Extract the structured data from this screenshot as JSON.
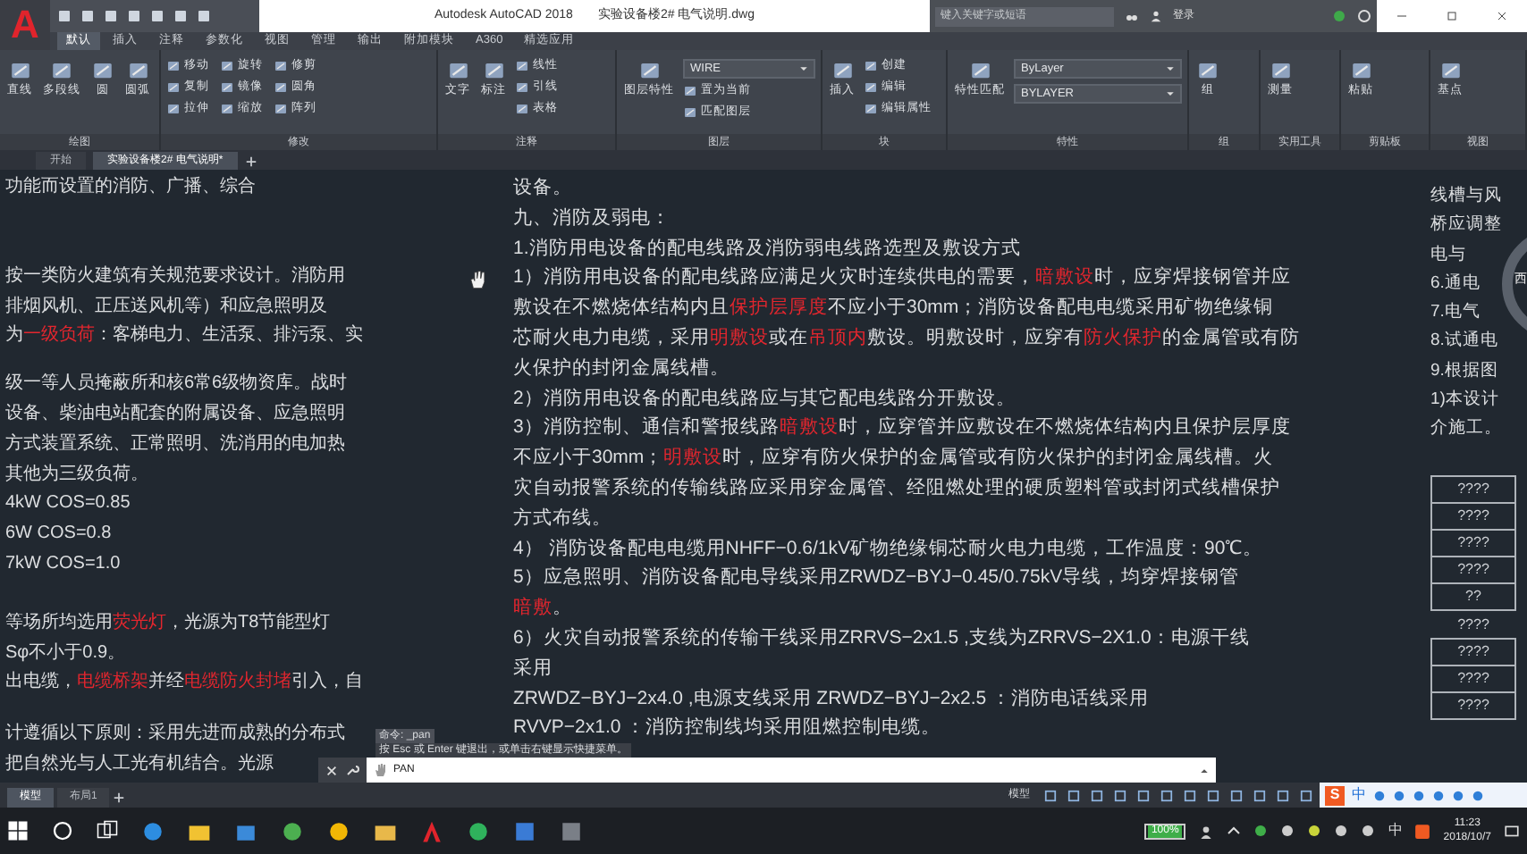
{
  "title_bar": {
    "logo": "A",
    "title": "Autodesk AutoCAD 2018",
    "file": "实验设备楼2# 电气说明.dwg",
    "search": {
      "placeholder": "键入关键字或短语"
    },
    "sign_in": "登录"
  },
  "ribbon_tabs": [
    {
      "label": "默认",
      "selected": true
    },
    {
      "label": "插入",
      "selected": false
    },
    {
      "label": "注释",
      "selected": false
    },
    {
      "label": "参数化",
      "selected": false
    },
    {
      "label": "视图",
      "selected": false
    },
    {
      "label": "管理",
      "selected": false
    },
    {
      "label": "输出",
      "selected": false
    },
    {
      "label": "附加模块",
      "selected": false
    },
    {
      "label": "A360",
      "selected": false
    },
    {
      "label": "精选应用",
      "selected": false
    }
  ],
  "ribbon_panels": [
    {
      "title": "绘图",
      "large": [
        "直线",
        "多段线",
        "圆",
        "圆弧"
      ]
    },
    {
      "title": "修改",
      "small": [
        "移动",
        "旋转",
        "修剪",
        "复制",
        "镜像",
        "圆角",
        "拉伸",
        "缩放",
        "阵列"
      ]
    },
    {
      "title": "注释",
      "large": [
        "文字",
        "标注"
      ],
      "small": [
        "线性",
        "引线",
        "表格"
      ]
    },
    {
      "title": "图层",
      "large": [
        "图层特性"
      ],
      "dropdowns": [
        "WIRE"
      ],
      "small": [
        "置为当前",
        "匹配图层"
      ]
    },
    {
      "title": "块",
      "large": [
        "插入"
      ],
      "small": [
        "创建",
        "编辑",
        "编辑属性"
      ]
    },
    {
      "title": "特性",
      "large": [
        "特性匹配"
      ],
      "dropdowns": [
        "ByLayer",
        "BYLAYER"
      ]
    },
    {
      "title": "组",
      "large": [
        "组"
      ]
    },
    {
      "title": "实用工具",
      "large": [
        "测量"
      ]
    },
    {
      "title": "剪贴板",
      "large": [
        "粘贴"
      ]
    },
    {
      "title": "视图",
      "large": [
        "基点"
      ]
    }
  ],
  "file_tabs": [
    {
      "label": "开始",
      "selected": false
    },
    {
      "label": "实验设备楼2# 电气说明*",
      "selected": true
    }
  ],
  "drawing": {
    "left_text": [
      [
        [
          {
            "text": "功能而设置的消防、广播、综合",
            "highlight": false
          }
        ]
      ],
      [
        [
          {
            "text": "按一类防火建筑有关规范要求设计。消防用",
            "highlight": false
          }
        ]
      ],
      [
        [
          {
            "text": "排烟风机、正压送风机等）和应急照明及",
            "highlight": false
          }
        ]
      ],
      [
        [
          {
            "text": "为",
            "highlight": false
          },
          {
            "text": "一级负荷",
            "highlight": true
          },
          {
            "text": "：客梯电力、生活泵、排污泵、实",
            "highlight": false
          }
        ]
      ],
      [
        [
          {
            "text": "级一等人员掩蔽所和核6常6级物资库。战时",
            "highlight": false
          }
        ]
      ],
      [
        [
          {
            "text": "设备、柴油电站配套的附属设备、应急照明",
            "highlight": false
          }
        ]
      ],
      [
        [
          {
            "text": "方式装置系统、正常照明、洗消用的电加热",
            "highlight": false
          }
        ]
      ],
      [
        [
          {
            "text": "其他为三级负荷。",
            "highlight": false
          }
        ]
      ],
      [
        [
          {
            "text": "4kW   COS=0.85",
            "highlight": false
          }
        ]
      ],
      [
        [
          {
            "text": "6W   COS=0.8",
            "highlight": false
          }
        ]
      ],
      [
        [
          {
            "text": "7kW   COS=1.0",
            "highlight": false
          }
        ]
      ],
      [
        [
          {
            "text": "等场所均选用",
            "highlight": false
          },
          {
            "text": "荧光灯",
            "highlight": true
          },
          {
            "text": "，光源为T8节能型灯",
            "highlight": false
          }
        ]
      ],
      [
        [
          {
            "text": "Sφ不小于0.9。",
            "highlight": false
          }
        ]
      ],
      [
        [
          {
            "text": "出电缆，",
            "highlight": false
          },
          {
            "text": "电缆桥架",
            "highlight": true
          },
          {
            "text": "并经",
            "highlight": false
          },
          {
            "text": "电缆防火封堵",
            "highlight": true
          },
          {
            "text": "引入，自",
            "highlight": false
          }
        ]
      ],
      [
        [
          {
            "text": "计遵循以下原则：采用先进而成熟的分布式",
            "highlight": false
          }
        ]
      ],
      [
        [
          {
            "text": "把自然光与人工光有机结合。光源",
            "highlight": false
          }
        ]
      ]
    ],
    "main_text": [
      [
        {
          "text": "设备。",
          "highlight": false
        }
      ],
      [
        {
          "text": "九、消防及弱电：",
          "highlight": false
        }
      ],
      [
        {
          "text": "1.消防用电设备的配电线路及消防弱电线路选型及敷设方式",
          "highlight": false
        }
      ],
      [
        {
          "text": "1）消防用电设备的配电线路应满足火灾时连续供电的需要，",
          "highlight": false
        },
        {
          "text": "暗敷设",
          "highlight": true
        },
        {
          "text": "时，应穿焊接钢管并应",
          "highlight": false
        }
      ],
      [
        {
          "text": "敷设在不燃烧体结构内且",
          "highlight": false
        },
        {
          "text": "保护层厚度",
          "highlight": true
        },
        {
          "text": "不应小于30mm；消防设备配电电缆采用矿物绝缘铜",
          "highlight": false
        }
      ],
      [
        {
          "text": "芯耐火电力电缆，采用",
          "highlight": false
        },
        {
          "text": "明敷设",
          "highlight": true
        },
        {
          "text": "或在",
          "highlight": false
        },
        {
          "text": "吊顶内",
          "highlight": true
        },
        {
          "text": "敷设。明敷设时，应穿有",
          "highlight": false
        },
        {
          "text": "防火保护",
          "highlight": true
        },
        {
          "text": "的金属管或有防",
          "highlight": false
        }
      ],
      [
        {
          "text": "火保护的封闭金属线槽。",
          "highlight": false
        }
      ],
      [
        {
          "text": "2）消防用电设备的配电线路应与其它配电线路分开敷设。",
          "highlight": false
        }
      ],
      [
        {
          "text": "3）消防控制、通信和警报线路",
          "highlight": false
        },
        {
          "text": "暗敷设",
          "highlight": true
        },
        {
          "text": "时，应穿管并应敷设在不燃烧体结构内且保护层厚度",
          "highlight": false
        }
      ],
      [
        {
          "text": "不应小于30mm；",
          "highlight": false
        },
        {
          "text": "明敷设",
          "highlight": true
        },
        {
          "text": "时，应穿有防火保护的金属管或有防火保护的封闭金属线槽。火",
          "highlight": false
        }
      ],
      [
        {
          "text": "灾自动报警系统的传输线路应采用穿金属管、经阻燃处理的硬质塑料管或封闭式线槽保护",
          "highlight": false
        }
      ],
      [
        {
          "text": "方式布线。",
          "highlight": false
        }
      ],
      [
        {
          "text": "4）  消防设备配电电缆用NHFF−0.6/1kV矿物绝缘铜芯耐火电力电缆，工作温度：90℃。",
          "highlight": false
        }
      ],
      [
        {
          "text": "5）应急照明、消防设备配电导线采用ZRWDZ−BYJ−0.45/0.75kV导线，均穿焊接钢管",
          "highlight": false
        }
      ],
      [
        {
          "text": "暗敷",
          "highlight": true
        },
        {
          "text": "。",
          "highlight": false
        }
      ],
      [
        {
          "text": "6）火灾自动报警系统的传输干线采用ZRRVS−2x1.5 ,支线为ZRRVS−2X1.0：电源干线",
          "highlight": false
        }
      ],
      [
        {
          "text": "采用",
          "highlight": false
        }
      ],
      [
        {
          "text": "ZRWDZ−BYJ−2x4.0 ,电源支线采用 ZRWDZ−BYJ−2x2.5 ：消防电话线采用",
          "highlight": false
        }
      ],
      [
        {
          "text": "RVVP−2x1.0 ：消防控制线均采用阻燃控制电缆。",
          "highlight": false
        }
      ]
    ],
    "right_text": [
      "线槽与风",
      "桥应调整",
      "电与",
      "6.通电",
      "7.电气",
      "8.试通电",
      "9.根据图",
      "1)本设计",
      "介施工。"
    ],
    "compass_label": "西",
    "table_rows": [
      {
        "text": "????",
        "boxed": true
      },
      {
        "text": "????",
        "boxed": true
      },
      {
        "text": "????",
        "boxed": true
      },
      {
        "text": "????",
        "boxed": true
      },
      {
        "text": "??",
        "boxed": true
      },
      {
        "text": "????",
        "boxed": false
      },
      {
        "text": "????",
        "boxed": true
      },
      {
        "text": "????",
        "boxed": true
      },
      {
        "text": "????",
        "boxed": true
      }
    ]
  },
  "command": {
    "history": "命令: _pan",
    "hint": "按 Esc 或 Enter 键退出，或单击右键显示快捷菜单。",
    "input": "PAN"
  },
  "layout_tabs": [
    {
      "label": "模型",
      "selected": true
    },
    {
      "label": "布局1",
      "selected": false
    }
  ],
  "status_bar": {
    "space": "模型"
  },
  "ime_bar": {
    "logo": "S",
    "mode": "中"
  },
  "taskbar": {
    "battery": "100%",
    "ime": "中",
    "time": "11:23",
    "date": "2018/10/7"
  }
}
